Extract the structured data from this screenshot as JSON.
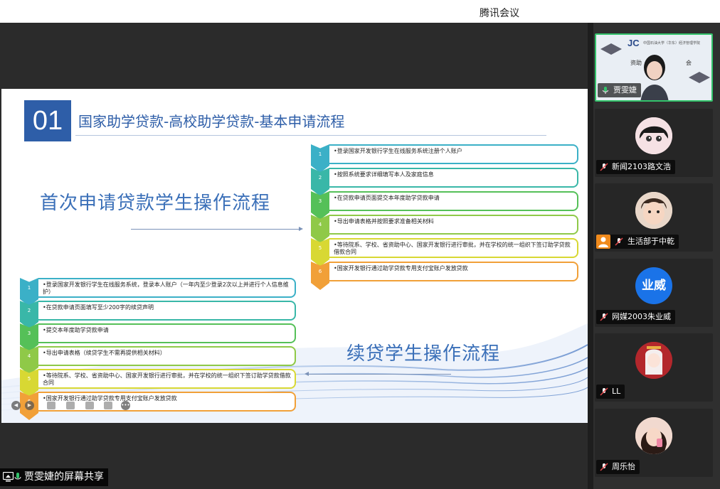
{
  "app": {
    "title": "腾讯会议"
  },
  "slide": {
    "number": "01",
    "title": "国家助学贷款-高校助学贷款-基本申请流程",
    "first_flow_title": "首次申请贷款学生操作流程",
    "renew_flow_title": "续贷学生操作流程",
    "first_steps": [
      {
        "n": "1",
        "text": "•登录国家开发银行学生在线服务系统注册个人账户",
        "color": "#3bb0c7"
      },
      {
        "n": "2",
        "text": "•按照系统要求详细填写本人及家庭信息",
        "color": "#39b7a8"
      },
      {
        "n": "3",
        "text": "•在贷款申请页面提交本年度助学贷款申请",
        "color": "#55c058"
      },
      {
        "n": "4",
        "text": "•导出申请表格并按照要求准备相关材料",
        "color": "#8fc948"
      },
      {
        "n": "5",
        "text": "•等待院系、学校、省资助中心、国家开发银行进行审批，并在学校的统一组织下签订助学贷款借款合同",
        "color": "#d8d833"
      },
      {
        "n": "6",
        "text": "•国家开发银行通过助学贷款专用支付宝账户发放贷款",
        "color": "#f1a038"
      }
    ],
    "renew_steps": [
      {
        "n": "1",
        "text": "•登录国家开发银行学生在线服务系统，登录本人账户（一年内至少登录2次以上并进行个人信息维护）",
        "color": "#3bb0c7"
      },
      {
        "n": "2",
        "text": "•在贷款申请页面填写至少200字的续贷声明",
        "color": "#39b7a8"
      },
      {
        "n": "3",
        "text": "•提交本年度助学贷款申请",
        "color": "#55c058"
      },
      {
        "n": "4",
        "text": "•导出申请表格（续贷学生不需再提供相关材料）",
        "color": "#8fc948"
      },
      {
        "n": "5",
        "text": "•等待院系、学校、省资助中心、国家开发银行进行审批，并在学校的统一组织下签订助学贷款借款合同",
        "color": "#d8d833"
      },
      {
        "n": "6",
        "text": "•国家开发银行通过助学贷款专用支付宝账户发放贷款",
        "color": "#f1a038"
      }
    ]
  },
  "video_tile": {
    "logo": "JC",
    "org_line": "中国石油大学（华东）经济管理学院",
    "text_left": "资助",
    "text_right": "会"
  },
  "participants": [
    {
      "name": "贾雯婕",
      "avatar_text": "",
      "avatar_color": ""
    },
    {
      "name": "新闻2103路文浩",
      "avatar_text": "",
      "avatar_color": "#f2d7da"
    },
    {
      "name": "生活部于中乾",
      "avatar_text": "",
      "avatar_color": "#e8d6c8"
    },
    {
      "name": "网媒2003朱业威",
      "avatar_text": "业威",
      "avatar_color": "#1a73e8"
    },
    {
      "name": "LL",
      "avatar_text": "",
      "avatar_color": "#b3272c"
    },
    {
      "name": "周乐怡",
      "avatar_text": "",
      "avatar_color": "#e7c5b8"
    }
  ],
  "share": {
    "label": "贾雯婕的屏幕共享"
  }
}
